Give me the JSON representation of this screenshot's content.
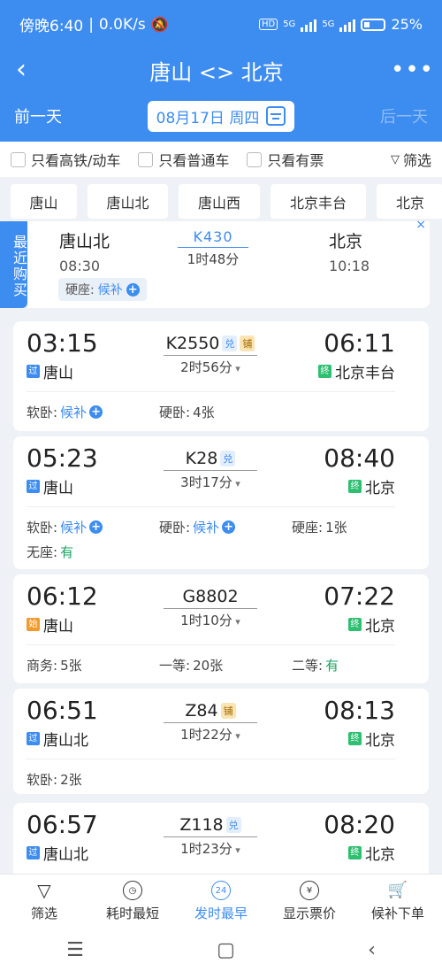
{
  "status": {
    "time": "傍晚6:40",
    "speed": "0.0K/s",
    "net1": "5G",
    "net2": "5G",
    "battery": "25%",
    "hd": "HD"
  },
  "nav": {
    "back": "‹",
    "title": "唐山 <> 北京",
    "more": "•••"
  },
  "dates": {
    "prev": "前一天",
    "current": "08月17日 周四",
    "next": "后一天"
  },
  "filters": {
    "high_speed": "只看高铁/动车",
    "normal": "只看普通车",
    "has_ticket": "只看有票",
    "screen": "筛选"
  },
  "stations": [
    "唐山",
    "唐山北",
    "唐山西",
    "北京丰台",
    "北京"
  ],
  "recent": {
    "tag": "最近购买",
    "close": "×",
    "from": "唐山北",
    "from_time": "08:30",
    "train_no": "K430",
    "duration": "1时48分",
    "to": "北京",
    "to_time": "10:18",
    "seat_label": "硬座:",
    "seat_value": "候补"
  },
  "trains": [
    {
      "dep": "03:15",
      "arr": "06:11",
      "no": "K2550",
      "badges": [
        "兑",
        "铺"
      ],
      "dur": "2时56分",
      "from": "唐山",
      "from_mark": "过",
      "to": "北京丰台",
      "to_mark": "终",
      "seats": [
        {
          "label": "软卧:",
          "value": "候补",
          "plus": true
        },
        {
          "label": "硬卧:",
          "value": "4张"
        }
      ]
    },
    {
      "dep": "05:23",
      "arr": "08:40",
      "no": "K28",
      "badges": [
        "兑"
      ],
      "dur": "3时17分",
      "from": "唐山",
      "from_mark": "过",
      "to": "北京",
      "to_mark": "终",
      "seats": [
        {
          "label": "软卧:",
          "value": "候补",
          "plus": true
        },
        {
          "label": "硬卧:",
          "value": "候补",
          "plus": true
        },
        {
          "label": "硬座:",
          "value": "1张"
        },
        {
          "label": "无座:",
          "value": "有"
        }
      ]
    },
    {
      "dep": "06:12",
      "arr": "07:22",
      "no": "G8802",
      "badges": [],
      "dur": "1时10分",
      "from": "唐山",
      "from_mark": "始",
      "to": "北京",
      "to_mark": "终",
      "seats": [
        {
          "label": "商务:",
          "value": "5张"
        },
        {
          "label": "一等:",
          "value": "20张"
        },
        {
          "label": "二等:",
          "value": "有"
        }
      ]
    },
    {
      "dep": "06:51",
      "arr": "08:13",
      "no": "Z84",
      "badges": [
        "铺"
      ],
      "dur": "1时22分",
      "from": "唐山北",
      "from_mark": "过",
      "to": "北京",
      "to_mark": "终",
      "seats": [
        {
          "label": "软卧:",
          "value": "2张"
        }
      ]
    },
    {
      "dep": "06:57",
      "arr": "08:20",
      "no": "Z118",
      "badges": [
        "兑"
      ],
      "dur": "1时23分",
      "from": "唐山北",
      "from_mark": "过",
      "to": "北京",
      "to_mark": "终",
      "seats": []
    }
  ],
  "tabs": [
    {
      "label": "筛选",
      "icon": "funnel-icon"
    },
    {
      "label": "耗时最短",
      "icon": "clock-icon"
    },
    {
      "label": "发时最早",
      "icon": "24h-icon",
      "icon_text": "24",
      "active": true
    },
    {
      "label": "显示票价",
      "icon": "yen-icon",
      "icon_text": "¥"
    },
    {
      "label": "候补下单",
      "icon": "cart-icon"
    }
  ],
  "sysnav": {
    "menu": "☰",
    "home": "▢",
    "back": "‹"
  }
}
